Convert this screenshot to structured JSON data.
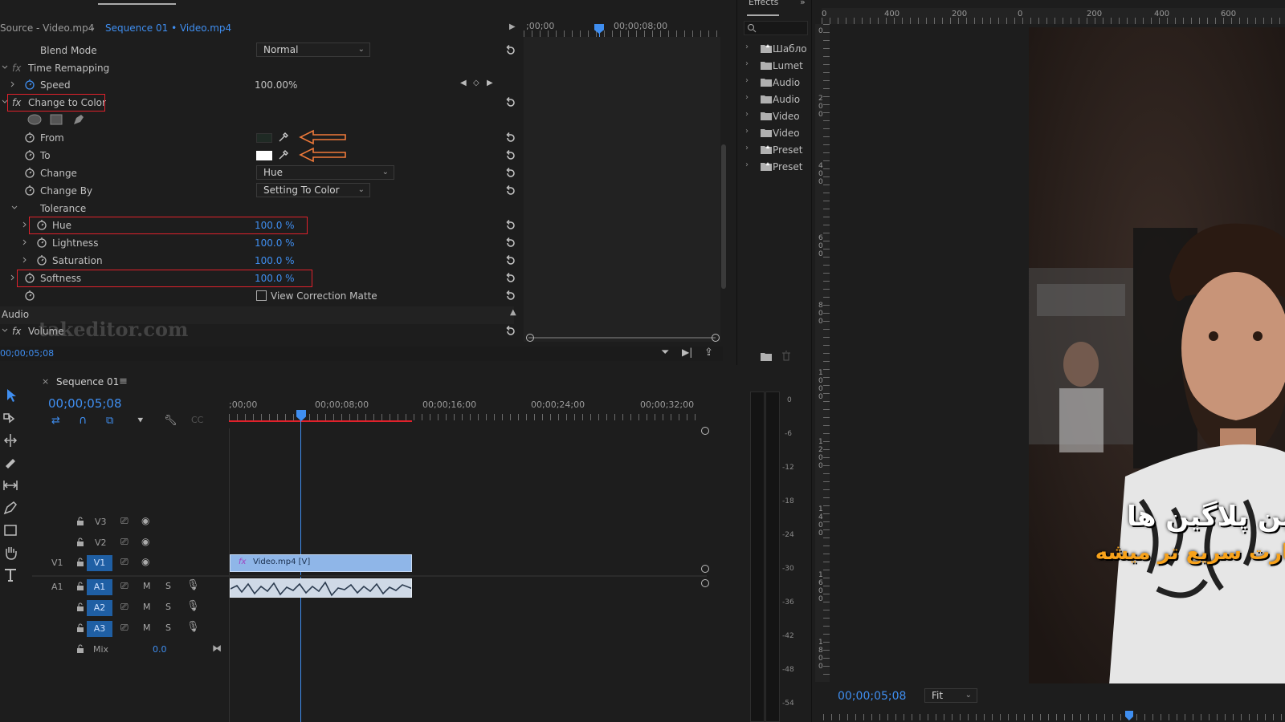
{
  "source_tabs": {
    "source": "Source - Video.mp4",
    "sequence": "Sequence 01 • Video.mp4"
  },
  "effect_controls": {
    "ruler_times": [
      ";00;00",
      "00;00;08;00"
    ],
    "timecode": "00;00;05;08",
    "blend_mode": {
      "label": "Blend Mode",
      "value": "Normal"
    },
    "time_remapping": {
      "label": "Time Remapping"
    },
    "speed": {
      "label": "Speed",
      "value": "100.00%"
    },
    "change_to_color": {
      "label": "Change to Color"
    },
    "from": {
      "label": "From",
      "color": "#1f2a24"
    },
    "to": {
      "label": "To",
      "color": "#ffffff"
    },
    "change": {
      "label": "Change",
      "value": "Hue"
    },
    "change_by": {
      "label": "Change By",
      "value": "Setting To Color"
    },
    "tolerance": {
      "label": "Tolerance"
    },
    "hue": {
      "label": "Hue",
      "value": "100.0 %"
    },
    "lightness": {
      "label": "Lightness",
      "value": "100.0 %"
    },
    "saturation": {
      "label": "Saturation",
      "value": "100.0 %"
    },
    "softness": {
      "label": "Softness",
      "value": "100.0 %"
    },
    "view_correction": {
      "label": "View Correction Matte",
      "checked": false
    },
    "audio": {
      "label": "Audio"
    },
    "volume": {
      "label": "Volume"
    },
    "watermark": "takeditor.com"
  },
  "effects_panel": {
    "title": "Effects",
    "items": [
      {
        "label": "Шабло",
        "icon": "folder-star-icon"
      },
      {
        "label": "Lumet",
        "icon": "folder-icon"
      },
      {
        "label": "Audio",
        "icon": "folder-icon"
      },
      {
        "label": "Audio",
        "icon": "folder-icon"
      },
      {
        "label": "Video",
        "icon": "folder-icon"
      },
      {
        "label": "Video",
        "icon": "folder-icon"
      },
      {
        "label": "Preset",
        "icon": "folder-star-icon"
      },
      {
        "label": "Preset",
        "icon": "folder-star-icon"
      }
    ]
  },
  "program": {
    "ruler_labels": [
      "400",
      "200",
      "0",
      "200",
      "400",
      "600"
    ],
    "vruler_labels": [
      "0",
      "2 0 0",
      "4 0 0",
      "6 0 0",
      "8 0 0",
      "1 0 0 0",
      "1 2 0 0",
      "1 4 0 0",
      "1 6 0 0",
      "1 8 0 0"
    ],
    "timecode": "00;00;05;08",
    "fit": "Fit",
    "overlay_line1": "این پلاگین ها",
    "overlay_line2": "کارت سریع تر میشه"
  },
  "timeline": {
    "tab": "Sequence 01",
    "timecode": "00;00;05;08",
    "ruler_times": [
      ";00;00",
      "00;00;08;00",
      "00;00;16;00",
      "00;00;24;00",
      "00;00;32;00"
    ],
    "tracks": {
      "v3": "V3",
      "v2": "V2",
      "v1_src": "V1",
      "v1": "V1",
      "a1_src": "A1",
      "a1": "A1",
      "a2": "A2",
      "a3": "A3",
      "mute": "M",
      "solo": "S",
      "mix": "Mix",
      "mix_value": "0.0"
    },
    "clip_video": "Video.mp4 [V]"
  },
  "meter_labels": [
    "0",
    "-6",
    "-12",
    "-18",
    "-24",
    "-30",
    "-36",
    "-42",
    "-48",
    "-54"
  ],
  "colors": {
    "accent": "#3f8ef0",
    "highlight": "#e0212b",
    "arrow": "#f07a3a",
    "clip": "#8fb6e8"
  }
}
